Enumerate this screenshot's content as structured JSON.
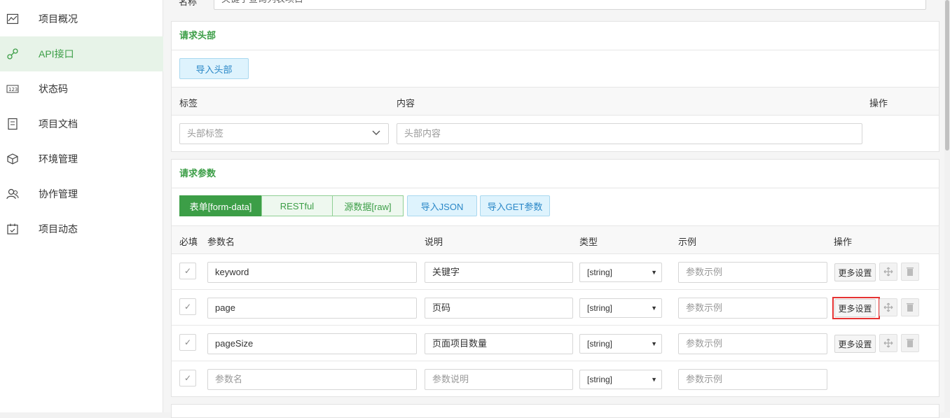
{
  "sidebar": {
    "items": [
      {
        "label": "项目概况",
        "icon": "chart-line-icon",
        "active": false
      },
      {
        "label": "API接口",
        "icon": "link-icon",
        "active": true
      },
      {
        "label": "状态码",
        "icon": "numbers-icon",
        "active": false
      },
      {
        "label": "项目文档",
        "icon": "document-icon",
        "active": false
      },
      {
        "label": "环境管理",
        "icon": "cube-icon",
        "active": false
      },
      {
        "label": "协作管理",
        "icon": "users-icon",
        "active": false
      },
      {
        "label": "项目动态",
        "icon": "calendar-icon",
        "active": false
      }
    ]
  },
  "top": {
    "label": "名称",
    "value": "关键字查询列表项目"
  },
  "request_headers": {
    "title": "请求头部",
    "import_button": "导入头部",
    "columns": {
      "tag": "标签",
      "content": "内容",
      "action": "操作"
    },
    "tag_placeholder": "头部标签",
    "content_placeholder": "头部内容"
  },
  "request_params": {
    "title": "请求参数",
    "tabs": [
      "表单[form-data]",
      "RESTful",
      "源数据[raw]"
    ],
    "active_tab": "表单[form-data]",
    "import_json": "导入JSON",
    "import_get": "导入GET参数",
    "columns": {
      "required": "必填",
      "name": "参数名",
      "desc": "说明",
      "type": "类型",
      "example": "示例",
      "action": "操作"
    },
    "rows": [
      {
        "name": "keyword",
        "desc": "关键字",
        "type": "[string]",
        "example_ph": "参数示例",
        "more": "更多设置"
      },
      {
        "name": "page",
        "desc": "页码",
        "type": "[string]",
        "example_ph": "参数示例",
        "more": "更多设置"
      },
      {
        "name": "pageSize",
        "desc": "页面项目数量",
        "type": "[string]",
        "example_ph": "参数示例",
        "more": "更多设置"
      }
    ],
    "new_row": {
      "name_ph": "参数名",
      "desc_ph": "参数说明",
      "type": "[string]",
      "example_ph": "参数示例"
    }
  },
  "colors": {
    "accent": "#3c9e47",
    "highlight": "#e53333"
  }
}
